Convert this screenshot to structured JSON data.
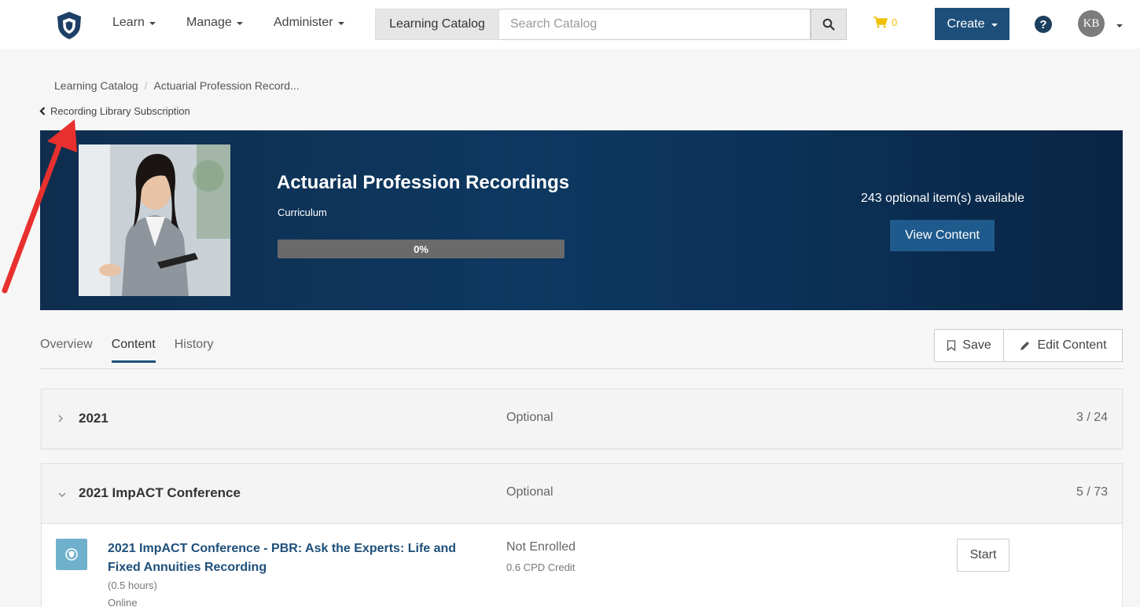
{
  "nav": {
    "items": [
      {
        "label": "Learn"
      },
      {
        "label": "Manage"
      },
      {
        "label": "Administer"
      }
    ],
    "catalog_label": "Learning Catalog",
    "search_placeholder": "Search Catalog",
    "cart_count": "0",
    "create_label": "Create",
    "help_glyph": "?",
    "avatar_initials": "KB"
  },
  "breadcrumb": {
    "items": [
      "Learning Catalog",
      "Actuarial Profession Record..."
    ],
    "separator": "/",
    "back_label": "Recording Library Subscription"
  },
  "banner": {
    "title": "Actuarial Profession Recordings",
    "type": "Curriculum",
    "progress_percent": 0,
    "progress_label": "0%",
    "optional_count": "243 optional item(s) available",
    "view_content_label": "View Content"
  },
  "tabs": [
    {
      "label": "Overview",
      "active": false
    },
    {
      "label": "Content",
      "active": true
    },
    {
      "label": "History",
      "active": false
    }
  ],
  "actions": {
    "save_label": "Save",
    "edit_label": "Edit Content"
  },
  "sections": [
    {
      "name": "2021",
      "status": "Optional",
      "count": "3 / 24",
      "expanded": false
    },
    {
      "name": "2021 ImpACT Conference",
      "status": "Optional",
      "count": "5 / 73",
      "expanded": true
    }
  ],
  "item": {
    "title": "2021 ImpACT Conference - PBR: Ask the Experts: Life and Fixed Annuities Recording",
    "duration": "(0.5 hours)",
    "mode": "Online",
    "status": "Not Enrolled",
    "credit": "0.6 CPD Credit",
    "start_label": "Start"
  },
  "colors": {
    "brand": "#1d4f7a",
    "banner_bg": "#0d3861",
    "annotation_arrow": "#e8302e",
    "cart": "#f0c000"
  },
  "icons": [
    "shield-logo-icon",
    "search-icon",
    "cart-icon",
    "help-icon",
    "back-chevron-icon",
    "bookmark-icon",
    "pencil-icon",
    "chevron-right-icon",
    "chevron-down-icon",
    "course-icon"
  ]
}
